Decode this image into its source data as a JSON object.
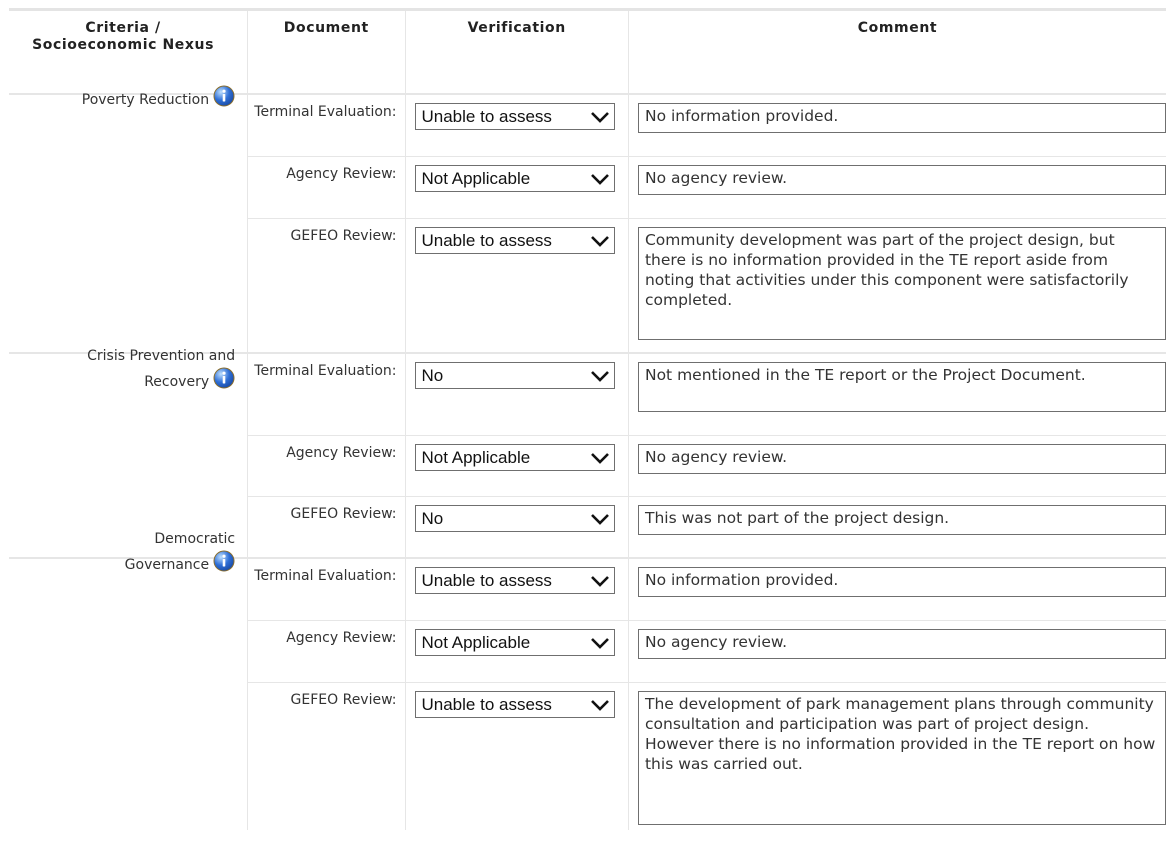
{
  "headers": {
    "criteria": "Criteria / Socioeconomic Nexus",
    "document": "Document",
    "verification": "Verification",
    "comment": "Comment"
  },
  "groups": [
    {
      "criteria": "Poverty Reduction",
      "rows": [
        {
          "document": "Terminal Evaluation:",
          "verification": "Unable to assess",
          "comment": "No information provided."
        },
        {
          "document": "Agency Review:",
          "verification": "Not Applicable",
          "comment": "No agency review."
        },
        {
          "document": "GEFEO Review:",
          "verification": "Unable to assess",
          "comment": "Community development was part of the project design, but there is no information provided in the TE report aside from noting that activities under this component were satisfactorily completed."
        }
      ]
    },
    {
      "criteria": "Crisis Prevention and Recovery",
      "rows": [
        {
          "document": "Terminal Evaluation:",
          "verification": "No",
          "comment": "Not mentioned in the TE report or the Project Document."
        },
        {
          "document": "Agency Review:",
          "verification": "Not Applicable",
          "comment": "No agency review."
        },
        {
          "document": "GEFEO Review:",
          "verification": "No",
          "comment": "This was not part of the project design."
        }
      ]
    },
    {
      "criteria": "Democratic Governance",
      "rows": [
        {
          "document": "Terminal Evaluation:",
          "verification": "Unable to assess",
          "comment": "No information provided."
        },
        {
          "document": "Agency Review:",
          "verification": "Not Applicable",
          "comment": "No agency review."
        },
        {
          "document": "GEFEO Review:",
          "verification": "Unable to assess",
          "comment": "The development of park management plans through community consultation and participation was part of project design. However there is no information provided in the TE report on how this was carried out."
        }
      ]
    }
  ],
  "icons": {
    "info": "info-icon",
    "dropdown": "chevron-down-icon"
  },
  "colors": {
    "border": "#e6e6e6",
    "control_border": "#6f6f6f",
    "info_blue": "#2f6fd6"
  }
}
